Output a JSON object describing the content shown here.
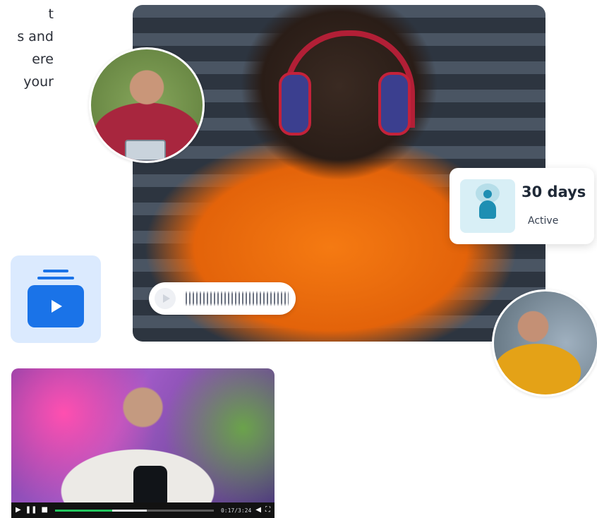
{
  "intro": {
    "lines": [
      "t",
      "s and",
      "ere",
      "your"
    ]
  },
  "status_card": {
    "value": "30 days",
    "label": "Active"
  },
  "video": {
    "time": "0:17/3:24",
    "progress": 0.36,
    "buffered": 0.58
  },
  "colors": {
    "accent": "#1a73e8",
    "status_tile": "#d8eff6",
    "progress_fill": "#22c55e"
  },
  "icons": {
    "audio_play": "play-icon",
    "waveform": "waveform-icon",
    "playlist": "playlist-video-icon",
    "status": "person-meditation-icon",
    "video_controls": [
      "play-icon",
      "pause-icon",
      "stop-icon",
      "volume-icon",
      "fullscreen-icon"
    ]
  }
}
